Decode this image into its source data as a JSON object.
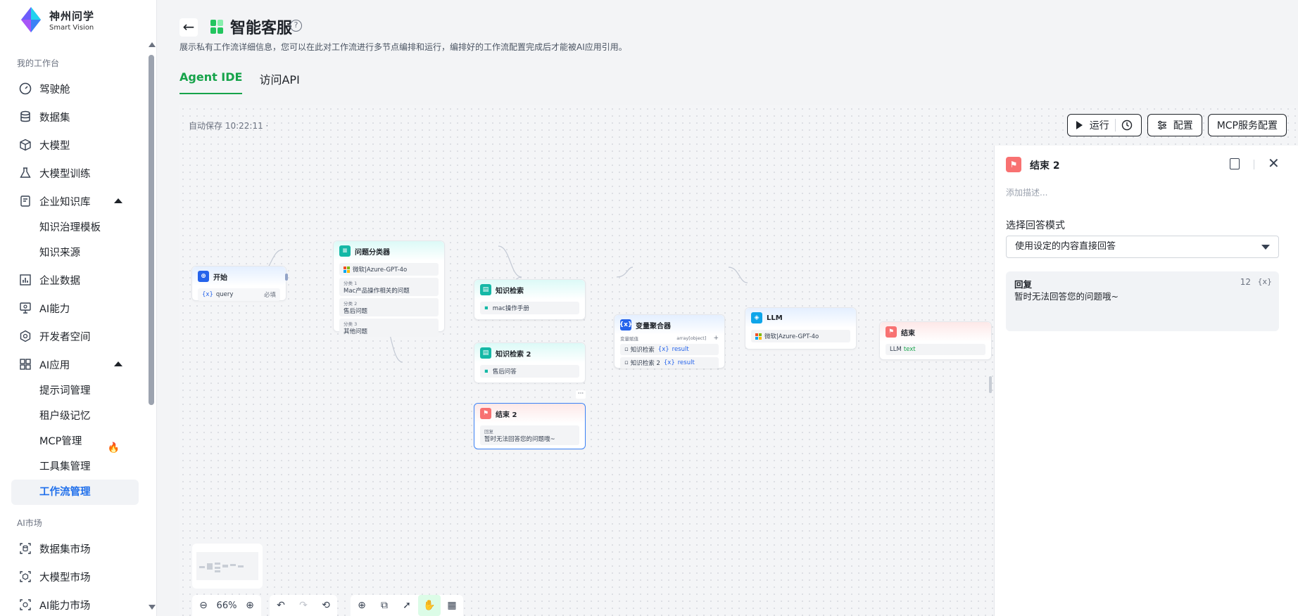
{
  "brand": {
    "name_cn": "神州问学",
    "name_en": "Smart Vision"
  },
  "sidebar": {
    "group1": "我的工作台",
    "items": [
      {
        "label": "驾驶舱",
        "icon": "gauge-icon"
      },
      {
        "label": "数据集",
        "icon": "database-icon"
      },
      {
        "label": "大模型",
        "icon": "cube-icon"
      },
      {
        "label": "大模型训练",
        "icon": "flask-icon"
      },
      {
        "label": "企业知识库",
        "icon": "notebook-icon"
      },
      {
        "label": "知识治理模板"
      },
      {
        "label": "知识来源"
      },
      {
        "label": "企业数据",
        "icon": "bar-chart-icon"
      },
      {
        "label": "AI能力",
        "icon": "monitor-icon"
      },
      {
        "label": "开发者空间",
        "icon": "hexagon-icon"
      },
      {
        "label": "AI应用",
        "icon": "apps-icon"
      },
      {
        "label": "提示词管理"
      },
      {
        "label": "租户级记忆"
      },
      {
        "label": "MCP管理"
      },
      {
        "label": "工具集管理"
      },
      {
        "label": "工作流管理"
      }
    ],
    "group2": "AI市场",
    "market": [
      {
        "label": "数据集市场"
      },
      {
        "label": "大模型市场"
      },
      {
        "label": "AI能力市场"
      }
    ]
  },
  "header": {
    "title": "智能客服",
    "subtitle": "展示私有工作流详细信息，您可以在此对工作流进行多节点编排和运行，编排好的工作流配置完成后才能被AI应用引用。",
    "tabs": [
      "Agent IDE",
      "访问API"
    ]
  },
  "canvas": {
    "autosave": "自动保存 10:22:11 ·",
    "buttons": {
      "run": "运行",
      "config": "配置",
      "mcp": "MCP服务配置"
    },
    "zoom": "66%"
  },
  "nodes": {
    "start": {
      "title": "开始",
      "var": "query",
      "required": "必填"
    },
    "classifier": {
      "title": "问题分类器",
      "model": "微软|Azure-GPT-4o",
      "c1_label": "分类 1",
      "c1": "Mac产品操作相关的问题",
      "c2_label": "分类 2",
      "c2": "售后问题",
      "c3_label": "分类 3",
      "c3": "其他问题"
    },
    "kb1": {
      "title": "知识检索",
      "item": "mac操作手册"
    },
    "kb2": {
      "title": "知识检索 2",
      "item": "售后问答"
    },
    "end2": {
      "title": "结束 2",
      "label": "回复",
      "text": "暂时无法回答您的问题哦~",
      "more": "···"
    },
    "agg": {
      "title": "变量聚合器",
      "col1": "变量赋值",
      "col2": "array[object]",
      "plus": "+",
      "r1": "知识检索",
      "r1v": "result",
      "r2": "知识检索 2",
      "r2v": "result"
    },
    "llm": {
      "title": "LLM",
      "model": "微软|Azure-GPT-4o"
    },
    "end": {
      "title": "结束",
      "v1": "LLM",
      "v2": "text"
    }
  },
  "panel": {
    "title": "结束 2",
    "desc_placeholder": "添加描述...",
    "mode_label": "选择回答模式",
    "mode_value": "使用设定的内容直接回答",
    "reply_title": "回复",
    "reply_count": "12",
    "reply_var": "{x}",
    "reply_text": "暂时无法回答您的问题哦~"
  },
  "colors": {
    "accent": "#16a34a",
    "active_link": "#1f6feb",
    "end_node": "#f87171"
  }
}
